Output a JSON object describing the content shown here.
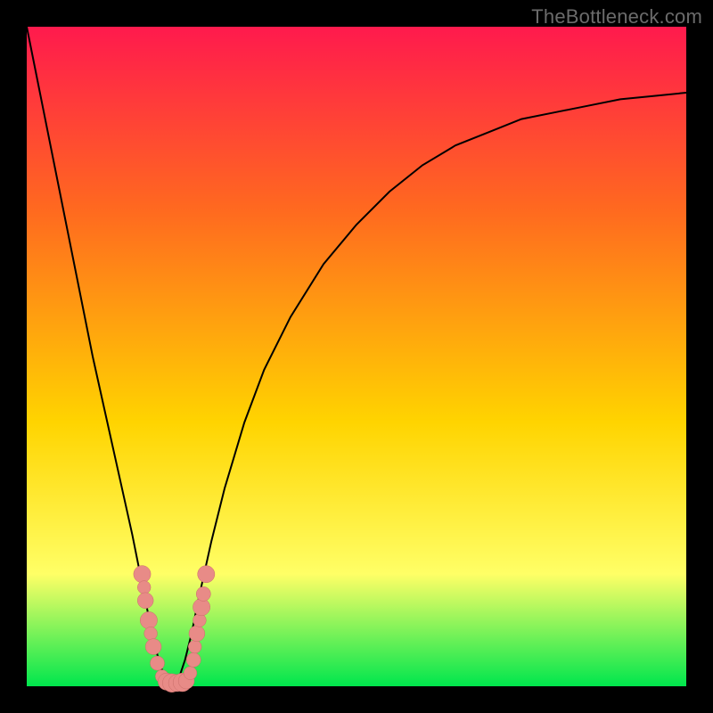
{
  "watermark": "TheBottleneck.com",
  "colors": {
    "bg": "#000000",
    "grad_top": "#ff1a4d",
    "grad_mid1": "#ff6a1f",
    "grad_mid2": "#ffd400",
    "grad_yellowband": "#ffff66",
    "grad_bottom": "#00e64d",
    "curve": "#000000",
    "marker_fill": "#e88b87",
    "marker_stroke": "#c96d69"
  },
  "chart_data": {
    "type": "line",
    "title": "",
    "xlabel": "",
    "ylabel": "",
    "xlim": [
      0,
      100
    ],
    "ylim": [
      0,
      100
    ],
    "grid": false,
    "legend": null,
    "series": [
      {
        "name": "bottleneck-curve",
        "x": [
          0,
          2,
          4,
          6,
          8,
          10,
          12,
          14,
          16,
          18,
          19,
          20,
          21,
          22,
          23,
          24,
          25,
          26,
          28,
          30,
          33,
          36,
          40,
          45,
          50,
          55,
          60,
          65,
          70,
          75,
          80,
          85,
          90,
          95,
          100
        ],
        "y": [
          100,
          90,
          80,
          70,
          60,
          50,
          41,
          32,
          23,
          13,
          8,
          4,
          1,
          0,
          1,
          4,
          8,
          13,
          22,
          30,
          40,
          48,
          56,
          64,
          70,
          75,
          79,
          82,
          84,
          86,
          87,
          88,
          89,
          89.5,
          90
        ]
      }
    ],
    "markers": [
      {
        "x": 17.5,
        "y": 17,
        "r": 1.3
      },
      {
        "x": 17.8,
        "y": 15,
        "r": 1.0
      },
      {
        "x": 18.0,
        "y": 13,
        "r": 1.2
      },
      {
        "x": 18.5,
        "y": 10,
        "r": 1.3
      },
      {
        "x": 18.8,
        "y": 8,
        "r": 1.0
      },
      {
        "x": 19.2,
        "y": 6,
        "r": 1.2
      },
      {
        "x": 19.8,
        "y": 3.5,
        "r": 1.1
      },
      {
        "x": 20.5,
        "y": 1.5,
        "r": 1.0
      },
      {
        "x": 21.2,
        "y": 0.7,
        "r": 1.3
      },
      {
        "x": 22.0,
        "y": 0.5,
        "r": 1.4
      },
      {
        "x": 22.8,
        "y": 0.5,
        "r": 1.3
      },
      {
        "x": 23.6,
        "y": 0.6,
        "r": 1.4
      },
      {
        "x": 24.2,
        "y": 0.8,
        "r": 1.2
      },
      {
        "x": 24.8,
        "y": 2,
        "r": 1.0
      },
      {
        "x": 25.3,
        "y": 4,
        "r": 1.1
      },
      {
        "x": 25.5,
        "y": 6,
        "r": 1.0
      },
      {
        "x": 25.8,
        "y": 8,
        "r": 1.2
      },
      {
        "x": 26.2,
        "y": 10,
        "r": 1.0
      },
      {
        "x": 26.5,
        "y": 12,
        "r": 1.3
      },
      {
        "x": 26.8,
        "y": 14,
        "r": 1.1
      },
      {
        "x": 27.2,
        "y": 17,
        "r": 1.3
      }
    ]
  }
}
